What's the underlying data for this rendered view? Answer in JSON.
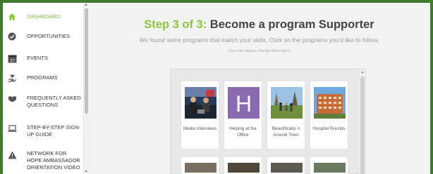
{
  "sidebar": {
    "items": [
      {
        "label": "DASHBOARD",
        "icon": "home-icon",
        "active": true
      },
      {
        "label": "OPPORTUNITIES",
        "icon": "check-circle-icon"
      },
      {
        "label": "EVENTS",
        "icon": "calendar-icon",
        "badge": "17"
      },
      {
        "label": "PROGRAMS",
        "icon": "hand-heart-icon"
      },
      {
        "label": "FREQUENTLY ASKED QUESTIONS",
        "icon": "handshake-icon"
      },
      {
        "label": "STEP-BY-STEP SIGN-UP GUIDE",
        "icon": "laptop-icon"
      },
      {
        "label": "NETWORK FOR HOPE AMBASSADOR ORIENTATION VIDEO",
        "icon": "warning-icon"
      }
    ]
  },
  "main": {
    "step_text": "Step 3 of 3:",
    "title_text": " Become a program Supporter",
    "subtitle": "We found some programs that match your skills. Click on the programs you'd like to follow.",
    "note": "(You can always change them later)",
    "programs": [
      {
        "label": "Media Interviews"
      },
      {
        "label": "Helping at the Office",
        "letter": "H"
      },
      {
        "label": "Beautificatio n Around Town"
      },
      {
        "label": "Hospital Rounds"
      }
    ]
  },
  "colors": {
    "accent": "#8cc63f",
    "border": "#3f7a2d",
    "tile_purple": "#8a6bb0"
  }
}
